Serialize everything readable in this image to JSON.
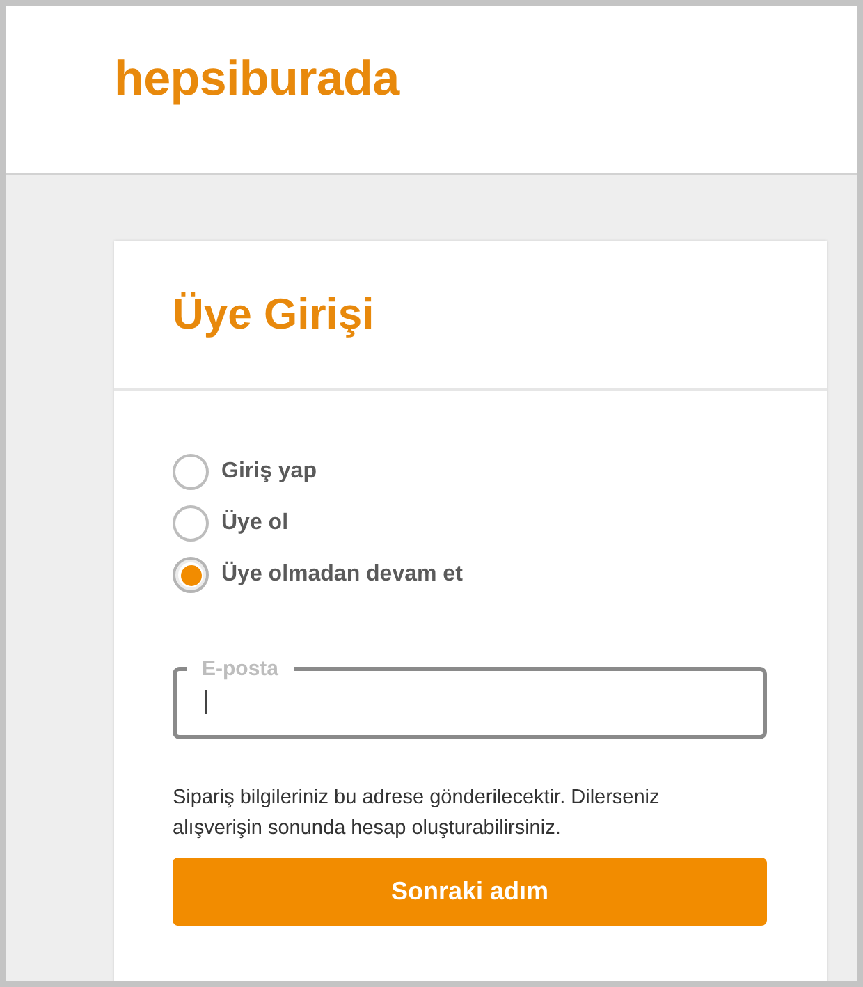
{
  "header": {
    "logo": "hepsiburada"
  },
  "card": {
    "title": "Üye Girişi",
    "options": [
      {
        "label": "Giriş yap",
        "selected": false
      },
      {
        "label": "Üye ol",
        "selected": false
      },
      {
        "label": "Üye olmadan devam et",
        "selected": true
      }
    ],
    "email_field": {
      "label": "E-posta",
      "focused": true
    },
    "note": "Sipariş bilgileriniz bu adrese gönderilecektir. Dilerseniz alışverişin sonunda hesap oluşturabilirsiniz.",
    "button": "Sonraki adım"
  }
}
